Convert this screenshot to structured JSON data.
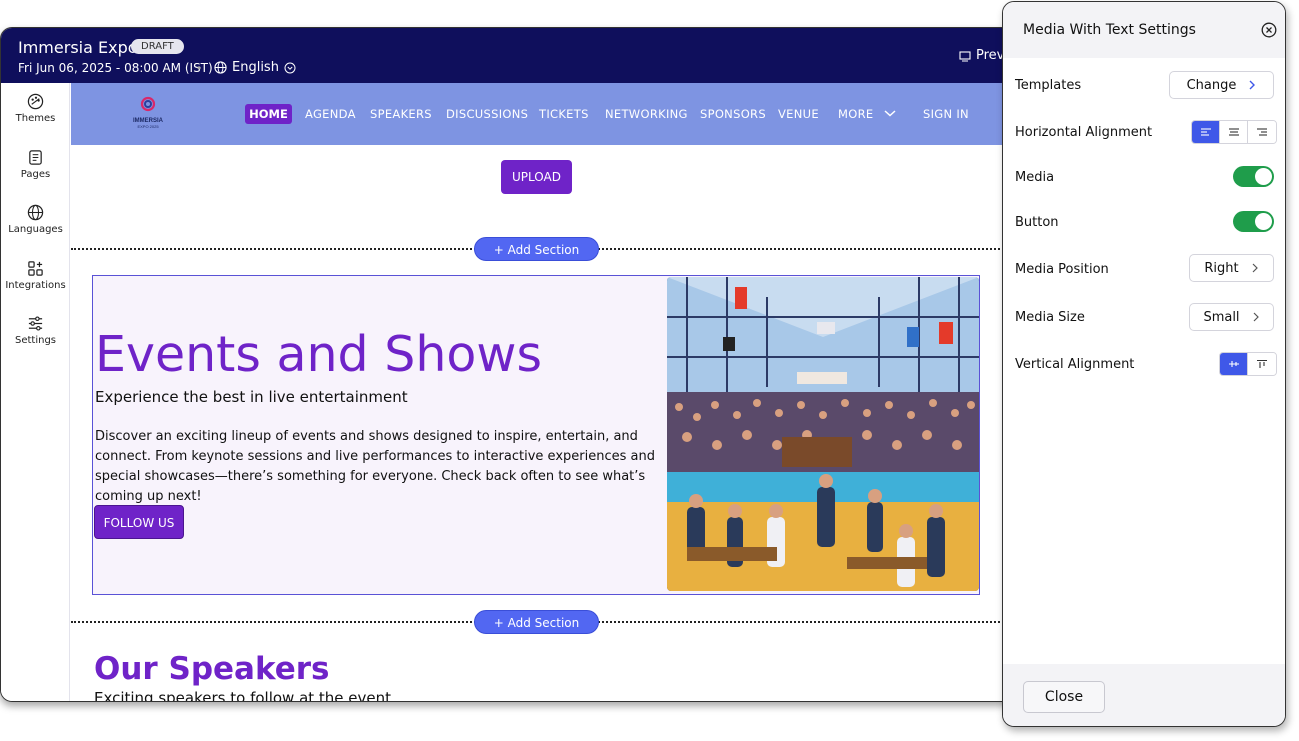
{
  "header": {
    "title": "Immersia Expo",
    "badge": "DRAFT",
    "date": "Fri Jun 06, 2025 - 08:00 AM (IST)",
    "language": "English",
    "preview_label": "Prev"
  },
  "sidebar": {
    "items": [
      {
        "label": "Themes",
        "icon": "palette-icon"
      },
      {
        "label": "Pages",
        "icon": "pages-icon"
      },
      {
        "label": "Languages",
        "icon": "globe-icon"
      },
      {
        "label": "Integrations",
        "icon": "integrations-icon"
      },
      {
        "label": "Settings",
        "icon": "sliders-icon"
      }
    ]
  },
  "site": {
    "logo_text": "IMMERSIA",
    "logo_sub": "EXPO 2025",
    "nav": [
      "HOME",
      "AGENDA",
      "SPEAKERS",
      "DISCUSSIONS",
      "TICKETS",
      "NETWORKING",
      "SPONSORS",
      "VENUE",
      "MORE",
      "SIGN IN"
    ],
    "upload_label": "UPLOAD",
    "add_section_label": "+ Add Section",
    "section": {
      "heading": "Events and Shows",
      "subheading": "Experience the best in live entertainment",
      "body": "Discover an exciting lineup of events and shows designed to inspire, entertain, and connect. From keynote sessions and live performances to interactive experiences and special showcases—there’s something for everyone. Check back often to see what’s coming up next!",
      "button_label": "FOLLOW US"
    },
    "speakers": {
      "title": "Our Speakers",
      "subtitle": "Exciting speakers to follow at the event"
    }
  },
  "panel": {
    "title": "Media With Text Settings",
    "templates_label": "Templates",
    "templates_value": "Change",
    "horizontal_alignment_label": "Horizontal Alignment",
    "horizontal_alignment_selected": "left",
    "media_label": "Media",
    "media_on": true,
    "button_label": "Button",
    "button_on": true,
    "media_position_label": "Media Position",
    "media_position_value": "Right",
    "media_size_label": "Media Size",
    "media_size_value": "Small",
    "vertical_alignment_label": "Vertical Alignment",
    "vertical_alignment_selected": "middle",
    "close_label": "Close"
  },
  "colors": {
    "topbar": "#0f0f5c",
    "nav_bg": "#7e94e2",
    "brand_purple": "#6f23c8",
    "add_section_blue": "#5267f2",
    "toggle_green": "#1f9d4b",
    "segment_active": "#3f58e8"
  }
}
